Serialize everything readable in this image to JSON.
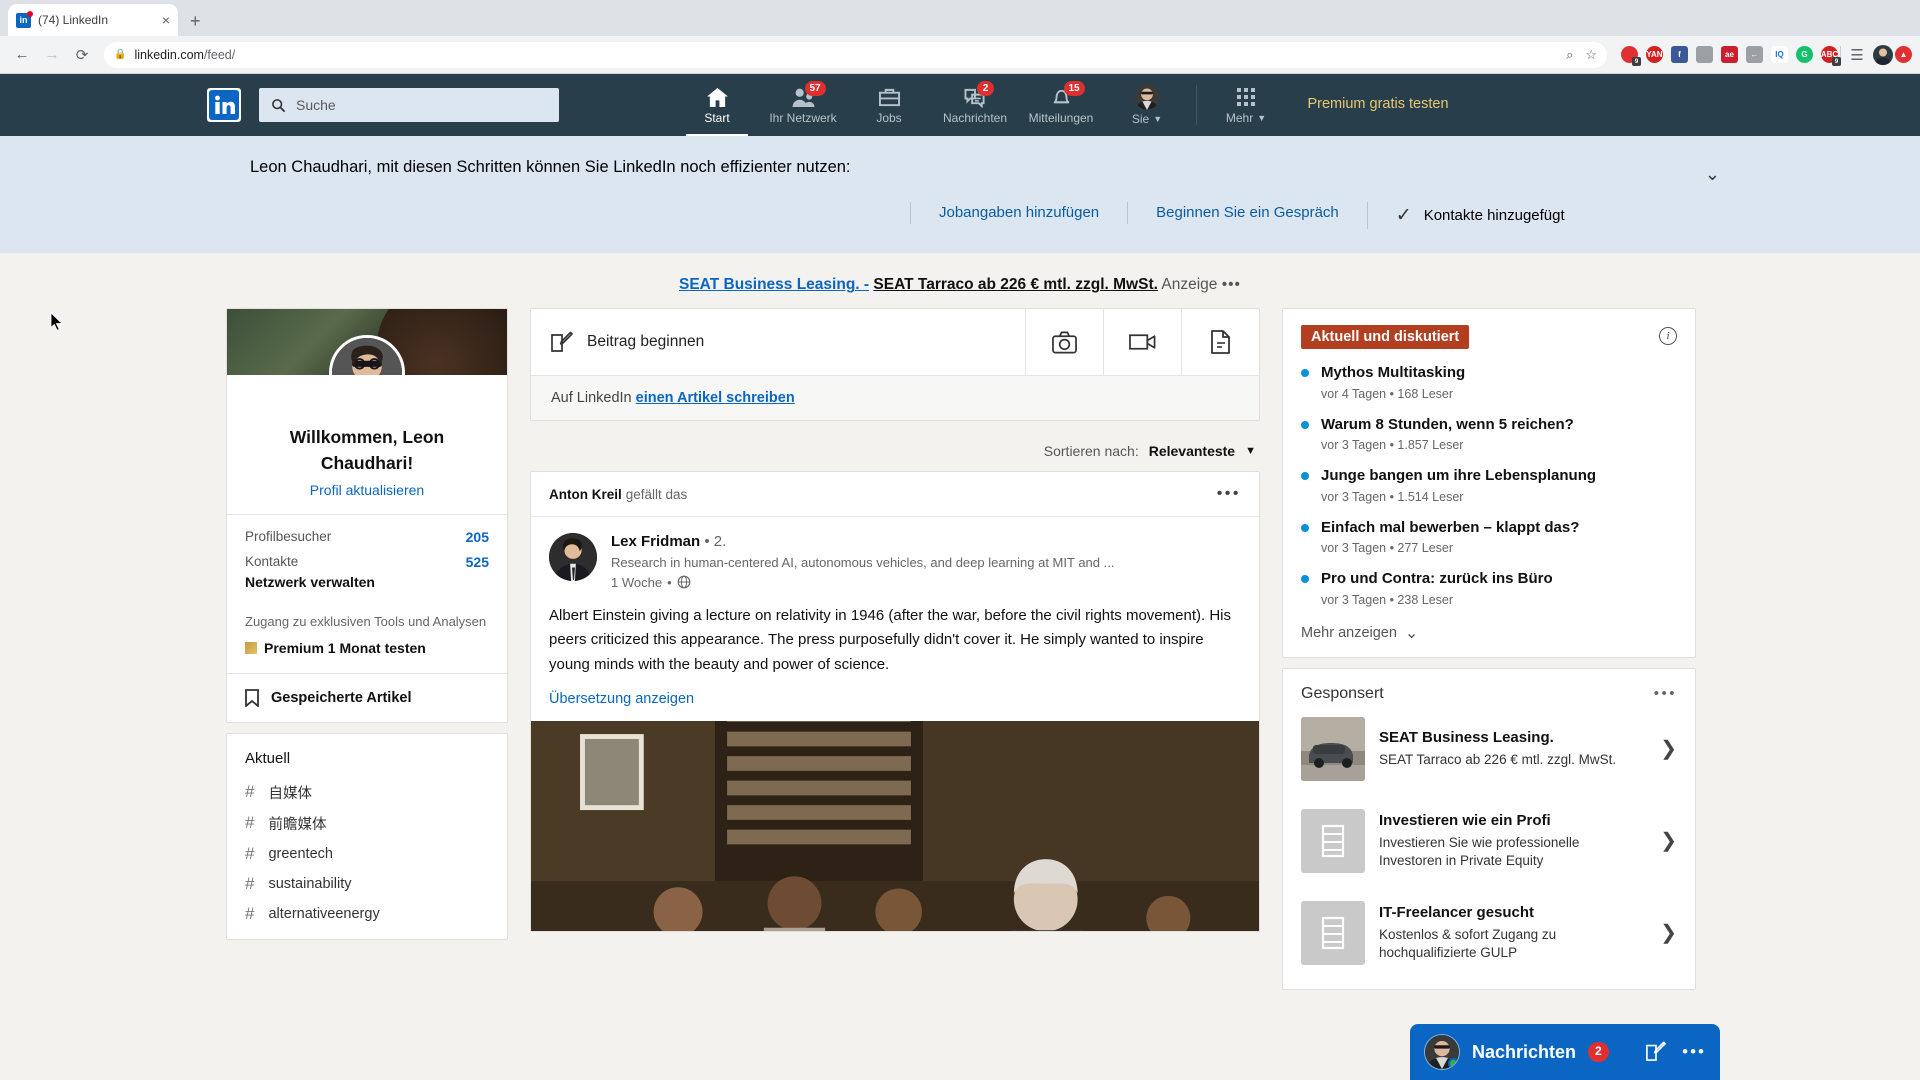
{
  "browser": {
    "tab": {
      "title": "(74) LinkedIn",
      "favicon": "linkedin-icon",
      "close": "×"
    },
    "new_tab": "+",
    "back": "←",
    "forward": "→",
    "reload": "⟳",
    "lock_icon": "lock-icon",
    "url_prefix": "linkedin.com",
    "url_path": "/feed/",
    "zoom_icon": "⌕",
    "bookmark_icon": "☆",
    "extensions": [
      {
        "name": "opera-shield-extension",
        "label": "",
        "color": "#e03030",
        "shape": "circle",
        "badge": "9"
      },
      {
        "name": "yandex-extension",
        "label": "YAN",
        "color": "#d32020",
        "shape": "circle",
        "badge": ""
      },
      {
        "name": "facebook-pixel-extension",
        "label": "f",
        "color": "#3b5998",
        "shape": "square",
        "badge": ""
      },
      {
        "name": "similarweb-extension",
        "label": "",
        "color": "#9aa0a6",
        "shape": "square",
        "badge": ""
      },
      {
        "name": "ae-adobe-extension",
        "label": "ae",
        "color": "#cc1f2d",
        "shape": "square",
        "badge": ""
      },
      {
        "name": "pocket-save-extension",
        "label": "←",
        "color": "#9aa0a6",
        "shape": "square",
        "badge": ""
      },
      {
        "name": "iq-extension",
        "label": "IQ",
        "color": "#ffffff",
        "shape": "square",
        "badge": ""
      },
      {
        "name": "grammarly-extension",
        "label": "G",
        "color": "#15c26b",
        "shape": "circle",
        "badge": ""
      },
      {
        "name": "adblock-extension",
        "label": "ABC",
        "color": "#d32020",
        "shape": "circle",
        "badge": "9"
      }
    ],
    "reading_list_icon": "☰♪",
    "profile_avatar": "user-avatar",
    "opera_menu_icon": "opera-icon"
  },
  "linkedin_nav": {
    "logo": "linkedin-logo",
    "search_placeholder": "Suche",
    "items": [
      {
        "name": "nav-home",
        "label": "Start",
        "icon": "home-icon",
        "badge": "",
        "active": true
      },
      {
        "name": "nav-network",
        "label": "Ihr Netzwerk",
        "icon": "people-icon",
        "badge": "57",
        "active": false
      },
      {
        "name": "nav-jobs",
        "label": "Jobs",
        "icon": "briefcase-icon",
        "badge": "",
        "active": false
      },
      {
        "name": "nav-messaging",
        "label": "Nachrichten",
        "icon": "message-icon",
        "badge": "2",
        "active": false
      },
      {
        "name": "nav-notifications",
        "label": "Mitteilungen",
        "icon": "bell-icon",
        "badge": "15",
        "active": false
      }
    ],
    "me": {
      "label": "Sie",
      "caret": "▼",
      "avatar": "me-avatar"
    },
    "more": {
      "label": "Mehr",
      "caret": "▼",
      "icon": "grid-icon"
    },
    "premium": "Premium gratis testen"
  },
  "onboarding": {
    "title": "Leon Chaudhari, mit diesen Schritten können Sie LinkedIn noch effizienter nutzen:",
    "steps": [
      {
        "label": "Jobangaben hinzufügen",
        "done": false
      },
      {
        "label": "Beginnen Sie ein Gespräch",
        "done": false
      },
      {
        "label": "Kontakte hinzugefügt",
        "done": true
      }
    ],
    "check_icon": "✓",
    "collapse_icon": "⌄"
  },
  "ad_strip": {
    "link_text": "SEAT Business Leasing. -",
    "headline": "SEAT Tarraco ab 226 € mtl. zzgl. MwSt.",
    "label": "Anzeige",
    "dots": "•••"
  },
  "profile": {
    "name": "Willkommen, Leon Chaudhari!",
    "update_link": "Profil aktualisieren",
    "stats": [
      {
        "label": "Profilbesucher",
        "value": "205"
      },
      {
        "label": "Kontakte",
        "value": "525"
      }
    ],
    "manage_network": "Netzwerk verwalten",
    "premium_text": "Zugang zu exklusiven Tools und Analysen",
    "premium_cta": "Premium 1 Monat testen",
    "saved_articles": "Gespeicherte Artikel",
    "saved_icon": "bookmark-icon"
  },
  "hashtags": {
    "title": "Aktuell",
    "items": [
      "自媒体",
      "前瞻媒体",
      "greentech",
      "sustainability",
      "alternativeenergy"
    ]
  },
  "share_box": {
    "placeholder": "Beitrag beginnen",
    "pencil_icon": "pencil-square-icon",
    "buttons": [
      {
        "name": "share-photo-button",
        "icon": "camera-icon"
      },
      {
        "name": "share-video-button",
        "icon": "video-icon"
      },
      {
        "name": "share-document-button",
        "icon": "document-icon"
      }
    ],
    "footer_prefix": "Auf LinkedIn",
    "footer_link": "einen Artikel schreiben"
  },
  "sort": {
    "label": "Sortieren nach:",
    "value": "Relevanteste",
    "caret": "▼"
  },
  "post": {
    "liked_by_name": "Anton Kreil",
    "liked_by_text": "gefällt das",
    "more_icon": "•••",
    "author": "Lex Fridman",
    "degree": "• 2.",
    "headline": "Research in human-centered AI, autonomous vehicles, and deep learning at MIT and ...",
    "time": "1 Woche",
    "visibility_icon": "globe-icon",
    "body": "Albert Einstein giving a lecture on relativity in 1946 (after the war, before the civil rights movement). His peers criticized this appearance. The press purposefully didn't cover it. He simply wanted to inspire young minds with the beauty and power of science.",
    "translate_link": "Übersetzung anzeigen"
  },
  "news": {
    "badge": "Aktuell und diskutiert",
    "info_icon": "info-icon",
    "items": [
      {
        "title": "Mythos Multitasking",
        "meta": "vor 4 Tagen • 168 Leser"
      },
      {
        "title": "Warum 8 Stunden, wenn 5 reichen?",
        "meta": "vor 3 Tagen • 1.857 Leser"
      },
      {
        "title": "Junge bangen um ihre Lebensplanung",
        "meta": "vor 3 Tagen • 1.514 Leser"
      },
      {
        "title": "Einfach mal bewerben – klappt das?",
        "meta": "vor 3 Tagen • 277 Leser"
      },
      {
        "title": "Pro und Contra: zurück ins Büro",
        "meta": "vor 3 Tagen • 238 Leser"
      }
    ],
    "show_more": "Mehr anzeigen",
    "show_more_caret": "⌄"
  },
  "sponsored": {
    "title": "Gesponsert",
    "dots": "•••",
    "items": [
      {
        "title": "SEAT Business Leasing.",
        "desc": "SEAT Tarraco ab 226 € mtl. zzgl. MwSt.",
        "thumb": "car-image",
        "arrow": "❯"
      },
      {
        "title": "Investieren wie ein Profi",
        "desc": "Investieren Sie wie professionelle Investoren in Private Equity",
        "thumb": "building-icon",
        "arrow": "❯"
      },
      {
        "title": "IT-Freelancer gesucht",
        "desc": "Kostenlos & sofort Zugang zu hochqualifizierte GULP",
        "thumb": "building-icon",
        "arrow": "❯"
      }
    ]
  },
  "messaging_overlay": {
    "label": "Nachrichten",
    "count": "2",
    "compose_icon": "compose-icon",
    "more_icon": "•••",
    "avatar": "me-avatar",
    "online_status": "online"
  },
  "colors": {
    "linkedin_blue": "#0a66c2",
    "nav_bg": "#283e4a",
    "badge_red": "#e02f2f",
    "news_badge": "#b24020",
    "premium_gold": "#e7c873",
    "page_bg": "#f3f2ef"
  }
}
